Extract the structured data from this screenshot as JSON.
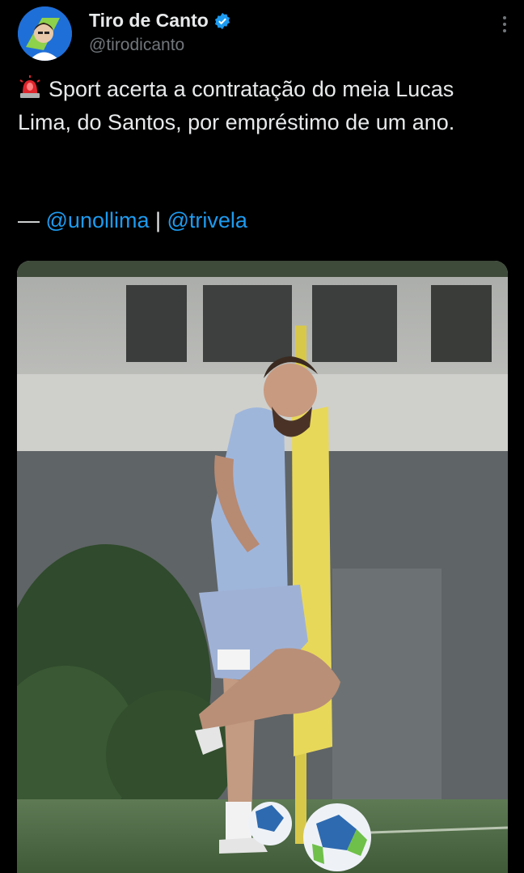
{
  "tweet": {
    "author": {
      "display_name": "Tiro de Canto",
      "handle": "@tirodicanto",
      "verified": true,
      "avatar_icon": "avatar-illustration-icon"
    },
    "text_main": "Sport acerta a contratação do meia Lucas Lima, do Santos, por empréstimo de um ano.",
    "credit_prefix": "— ",
    "credit_mention_1": "@unollima",
    "credit_separator": " | ",
    "credit_mention_2": "@trivela",
    "emoji_icon": "police-light-siren-icon",
    "media_description_icon": "photo-player-training-icon"
  },
  "colors": {
    "background": "#000000",
    "text": "#e7e9ea",
    "secondary": "#71767b",
    "link": "#1d9bf0",
    "verified": "#1d9bf0"
  }
}
